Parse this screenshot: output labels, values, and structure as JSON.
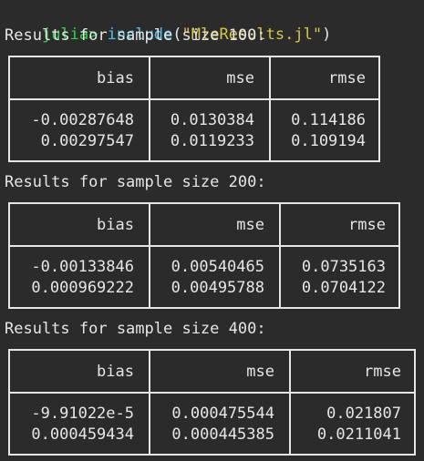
{
  "prompt": {
    "label": "julia>",
    "fn": "include",
    "open": "(",
    "arg": "\"MleResults.jl\"",
    "close": ")"
  },
  "columns": [
    "bias",
    "mse",
    "rmse"
  ],
  "tables": [
    {
      "heading": "Results for sample size 100:",
      "rows": [
        [
          "-0.00287648",
          "0.0130384",
          "0.114186"
        ],
        [
          "0.00297547",
          "0.0119233",
          "0.109194"
        ]
      ]
    },
    {
      "heading": "Results for sample size 200:",
      "rows": [
        [
          "-0.00133846",
          "0.00540465",
          "0.0735163"
        ],
        [
          "0.000969222",
          "0.00495788",
          "0.0704122"
        ]
      ]
    },
    {
      "heading": "Results for sample size 400:",
      "rows": [
        [
          "-9.91022e-5",
          "0.000475544",
          "0.021807"
        ],
        [
          "0.000459434",
          "0.000445385",
          "0.0211041"
        ]
      ]
    }
  ]
}
